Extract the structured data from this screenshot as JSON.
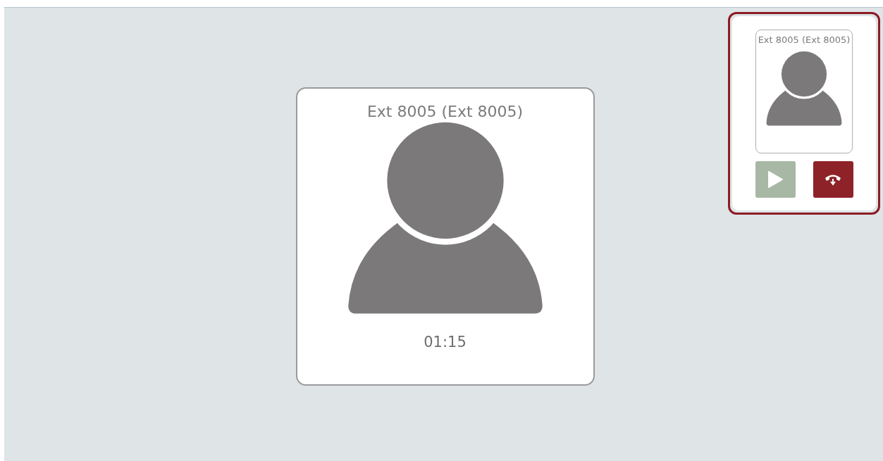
{
  "main_call": {
    "name": "Ext 8005 (Ext 8005)",
    "timer": "01:15"
  },
  "side_calls": [
    {
      "name": "Ext 8005 (Ext 8005)",
      "selected": true,
      "actions": [
        {
          "kind": "play"
        },
        {
          "kind": "hangup"
        }
      ]
    }
  ]
}
